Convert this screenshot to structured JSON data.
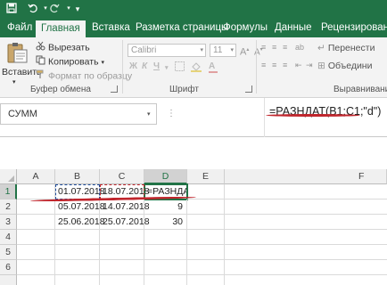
{
  "quick_access": {
    "save_icon": "floppy-disk-icon",
    "undo_icon": "undo-icon",
    "redo_icon": "redo-icon",
    "customize_icon": "chevron-down-icon"
  },
  "tabs": [
    {
      "label": "Файл",
      "active": false
    },
    {
      "label": "Главная",
      "active": true
    },
    {
      "label": "Вставка",
      "active": false
    },
    {
      "label": "Разметка страницы",
      "active": false
    },
    {
      "label": "Формулы",
      "active": false
    },
    {
      "label": "Данные",
      "active": false
    },
    {
      "label": "Рецензирование",
      "active": false
    }
  ],
  "ribbon": {
    "clipboard": {
      "paste_label": "Вставить",
      "cut_label": "Вырезать",
      "copy_label": "Копировать",
      "format_painter_label": "Формат по образцу",
      "group_label": "Буфер обмена"
    },
    "font": {
      "font_name": "Calibri",
      "font_size": "11",
      "group_label": "Шрифт"
    },
    "alignment": {
      "wrap_label": "Перенести",
      "merge_label": "Объедини",
      "group_label": "Выравнивани"
    }
  },
  "formula_bar": {
    "name_box": "СУММ",
    "formula": "=РАЗНДАТ(B1;C1;\"d\")"
  },
  "sheet": {
    "columns": [
      "A",
      "B",
      "C",
      "D",
      "E",
      "F"
    ],
    "rows": [
      "1",
      "2",
      "3",
      "4",
      "5",
      "6"
    ],
    "cells": {
      "B1": "01.07.2018",
      "C1": "18.07.2018",
      "D1": "=РАЗНДАТ",
      "B2": "05.07.2018",
      "C2": "14.07.2018",
      "D2": "9",
      "B3": "25.06.2018",
      "C3": "25.07.2018",
      "D3": "30"
    }
  },
  "colors": {
    "excel_green": "#217346",
    "annotation_red": "#c0262d"
  }
}
